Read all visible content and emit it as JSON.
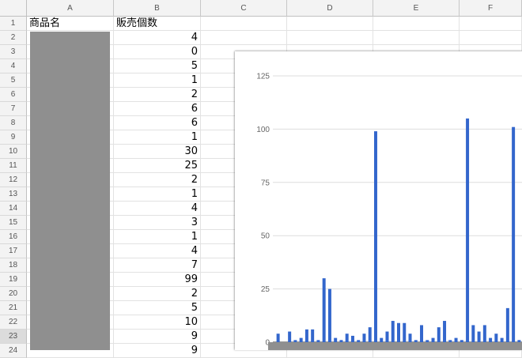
{
  "columns": [
    "A",
    "B",
    "C",
    "D",
    "E",
    "F"
  ],
  "header_row": {
    "product_name": "商品名",
    "sales_count": "販売個数"
  },
  "rows": [
    {
      "n": "1"
    },
    {
      "n": "2",
      "v": "4"
    },
    {
      "n": "3",
      "v": "0"
    },
    {
      "n": "4",
      "v": "5"
    },
    {
      "n": "5",
      "v": "1"
    },
    {
      "n": "6",
      "v": "2"
    },
    {
      "n": "7",
      "v": "6"
    },
    {
      "n": "8",
      "v": "6"
    },
    {
      "n": "9",
      "v": "1"
    },
    {
      "n": "10",
      "v": "30"
    },
    {
      "n": "11",
      "v": "25"
    },
    {
      "n": "12",
      "v": "2"
    },
    {
      "n": "13",
      "v": "1"
    },
    {
      "n": "14",
      "v": "4"
    },
    {
      "n": "15",
      "v": "3"
    },
    {
      "n": "16",
      "v": "1"
    },
    {
      "n": "17",
      "v": "4"
    },
    {
      "n": "18",
      "v": "7"
    },
    {
      "n": "19",
      "v": "99"
    },
    {
      "n": "20",
      "v": "2"
    },
    {
      "n": "21",
      "v": "5"
    },
    {
      "n": "22",
      "v": "10"
    },
    {
      "n": "23",
      "v": "9"
    },
    {
      "n": "24",
      "v": "9"
    }
  ],
  "colors": {
    "bar": "#3366cc",
    "redaction": "#8f8f8f"
  },
  "chart_data": {
    "type": "bar",
    "title": "",
    "xlabel": "",
    "ylabel": "",
    "ylim": [
      0,
      125
    ],
    "yticks": [
      "0",
      "25",
      "50",
      "75",
      "100",
      "125"
    ],
    "grid": true,
    "values": [
      4,
      0,
      5,
      1,
      2,
      6,
      6,
      1,
      30,
      25,
      2,
      1,
      4,
      3,
      1,
      4,
      7,
      99,
      2,
      5,
      10,
      9,
      9,
      4,
      1,
      8,
      1,
      2,
      7,
      10,
      1,
      2,
      1,
      105,
      8,
      5,
      8,
      2,
      4,
      2,
      16,
      101,
      1
    ]
  }
}
